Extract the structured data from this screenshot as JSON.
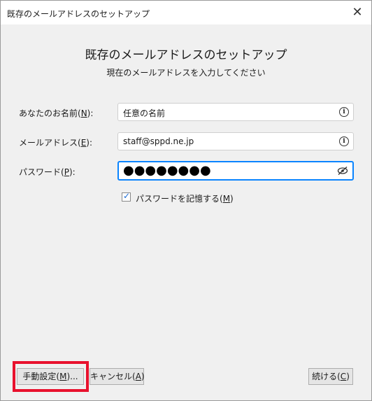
{
  "window": {
    "title": "既存のメールアドレスのセットアップ",
    "close_glyph": "✕"
  },
  "header": {
    "title": "既存のメールアドレスのセットアップ",
    "subtitle": "現在のメールアドレスを入力してください"
  },
  "form": {
    "name": {
      "label_prefix": "あなたのお名前(",
      "label_key": "N",
      "label_suffix": "):",
      "value": "任意の名前"
    },
    "email": {
      "label_prefix": "メールアドレス(",
      "label_key": "E",
      "label_suffix": "):",
      "value": "staff@sppd.ne.jp"
    },
    "password": {
      "label_prefix": "パスワード(",
      "label_key": "P",
      "label_suffix": "):",
      "value": "●●●●●●●●"
    },
    "remember": {
      "checked": true,
      "label_prefix": "パスワードを記憶する(",
      "label_key": "M",
      "label_suffix": ")"
    }
  },
  "buttons": {
    "manual": {
      "prefix": "手動設定(",
      "key": "M",
      "suffix": ")..."
    },
    "cancel": {
      "prefix": "キャンセル(",
      "key": "A",
      "suffix": ")"
    },
    "continue": {
      "prefix": "続ける(",
      "key": "C",
      "suffix": ")"
    }
  },
  "icons": {
    "info": "i",
    "check": "✓"
  },
  "colors": {
    "highlight": "#e8112d",
    "focus_border": "#0a84ff"
  }
}
